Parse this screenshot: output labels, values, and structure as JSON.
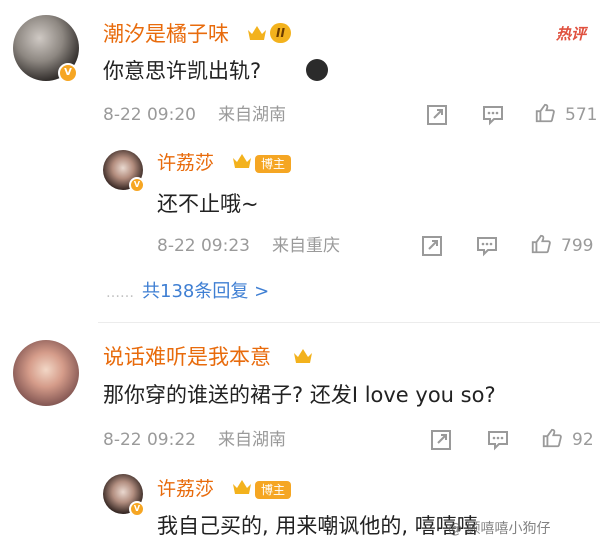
{
  "comments": [
    {
      "username": "潮汐是橘子味",
      "level": "II",
      "hot_label": "热评",
      "text": "你意思许凯出轨?",
      "emoji": "cry-emoji",
      "date": "8-22 09:20",
      "location": "来自湖南",
      "likes": "571",
      "replies": [
        {
          "username": "许荔莎",
          "badge": "博主",
          "text": "还不止哦~",
          "date": "8-22 09:23",
          "location": "来自重庆",
          "likes": "799"
        }
      ],
      "more_replies": "共138条回复 >"
    },
    {
      "username": "说话难听是我本意",
      "text": "那你穿的谁送的裙子? 还发I love you so?",
      "date": "8-22 09:22",
      "location": "来自湖南",
      "likes": "92",
      "replies": [
        {
          "username": "许荔莎",
          "badge": "博主",
          "text": "我自己买的, 用来嘲讽他的, 嘻嘻嘻"
        }
      ]
    }
  ],
  "watermark": "@ 顾嘻嘻小狗仔",
  "colors": {
    "name": "#e86b0c",
    "link": "#3f7fd3",
    "meta": "#9a9a9a",
    "badge": "#f5a623"
  }
}
